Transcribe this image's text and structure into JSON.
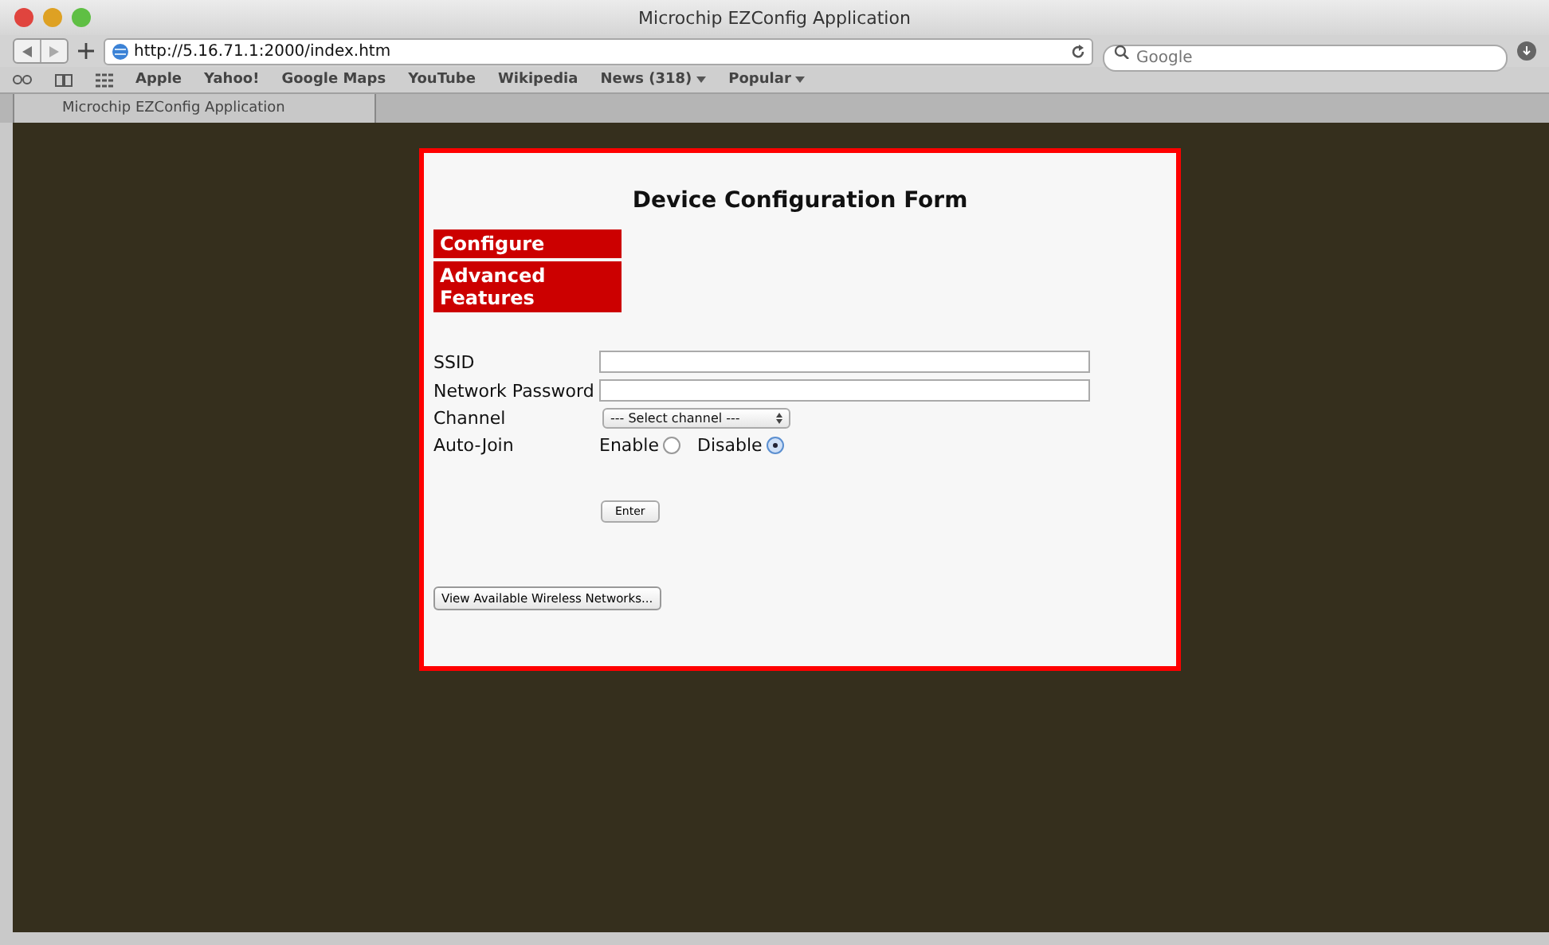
{
  "window": {
    "title": "Microchip EZConfig Application"
  },
  "toolbar": {
    "url": "http://5.16.71.1:2000/index.htm",
    "search": {
      "placeholder": "Google"
    }
  },
  "bookmarks": [
    {
      "label": "Apple",
      "menu": false
    },
    {
      "label": "Yahoo!",
      "menu": false
    },
    {
      "label": "Google Maps",
      "menu": false
    },
    {
      "label": "YouTube",
      "menu": false
    },
    {
      "label": "Wikipedia",
      "menu": false
    },
    {
      "label": "News (318)",
      "menu": true
    },
    {
      "label": "Popular",
      "menu": true
    }
  ],
  "tabs": [
    {
      "label": "Microchip EZConfig Application",
      "selected": true
    }
  ],
  "form": {
    "title": "Device Configuration Form",
    "nav": [
      "Configure",
      "Advanced Features"
    ],
    "fields": [
      {
        "kind": "text",
        "label": "SSID"
      },
      {
        "kind": "text",
        "label": "Network Password"
      },
      {
        "kind": "select",
        "label": "Channel",
        "value": "--- Select channel ---"
      },
      {
        "kind": "radio",
        "label": "Auto-Join",
        "options": [
          {
            "label": "Enable",
            "selected": false
          },
          {
            "label": "Disable",
            "selected": true
          }
        ]
      }
    ],
    "submit": "Enter",
    "networks_button": "View Available Wireless Networks..."
  }
}
